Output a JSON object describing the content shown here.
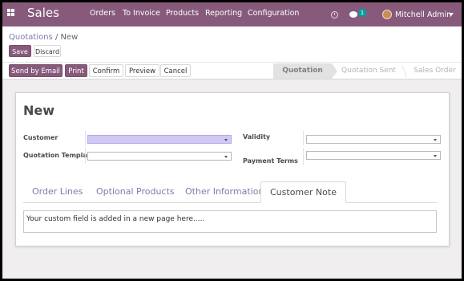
{
  "navbar": {
    "app_name": "Sales",
    "menu": [
      "Orders",
      "To Invoice",
      "Products",
      "Reporting",
      "Configuration"
    ],
    "message_count": "1",
    "user_name": "Mitchell Admin",
    "color": "#875a7b"
  },
  "breadcrumb": {
    "parent": "Quotations",
    "separator": "/",
    "current": "New"
  },
  "toolbar": {
    "save": "Save",
    "discard": "Discard"
  },
  "actions": [
    "Send by Email",
    "Print",
    "Confirm",
    "Preview",
    "Cancel"
  ],
  "statusbar": {
    "stages": [
      "Quotation",
      "Quotation Sent",
      "Sales Order"
    ],
    "active_stage": "Quotation"
  },
  "form": {
    "title": "New",
    "customer_label": "Customer",
    "quotation_template_label": "Quotation Template",
    "validity_label": "Validity",
    "payment_terms_label": "Payment Terms",
    "customer_value": "",
    "quotation_template_value": "",
    "validity_value": "",
    "payment_terms_value": ""
  },
  "tabs": [
    "Order Lines",
    "Optional Products",
    "Other Information",
    "Customer Note"
  ],
  "active_tab": "Customer Note",
  "note_text": "Your custom field is added in a new page here.....",
  "icons": {
    "apps": "apps-grid-icon",
    "activity": "clock-icon",
    "messages": "chat-bubble-icon",
    "user_menu": "chevron-down-icon"
  }
}
